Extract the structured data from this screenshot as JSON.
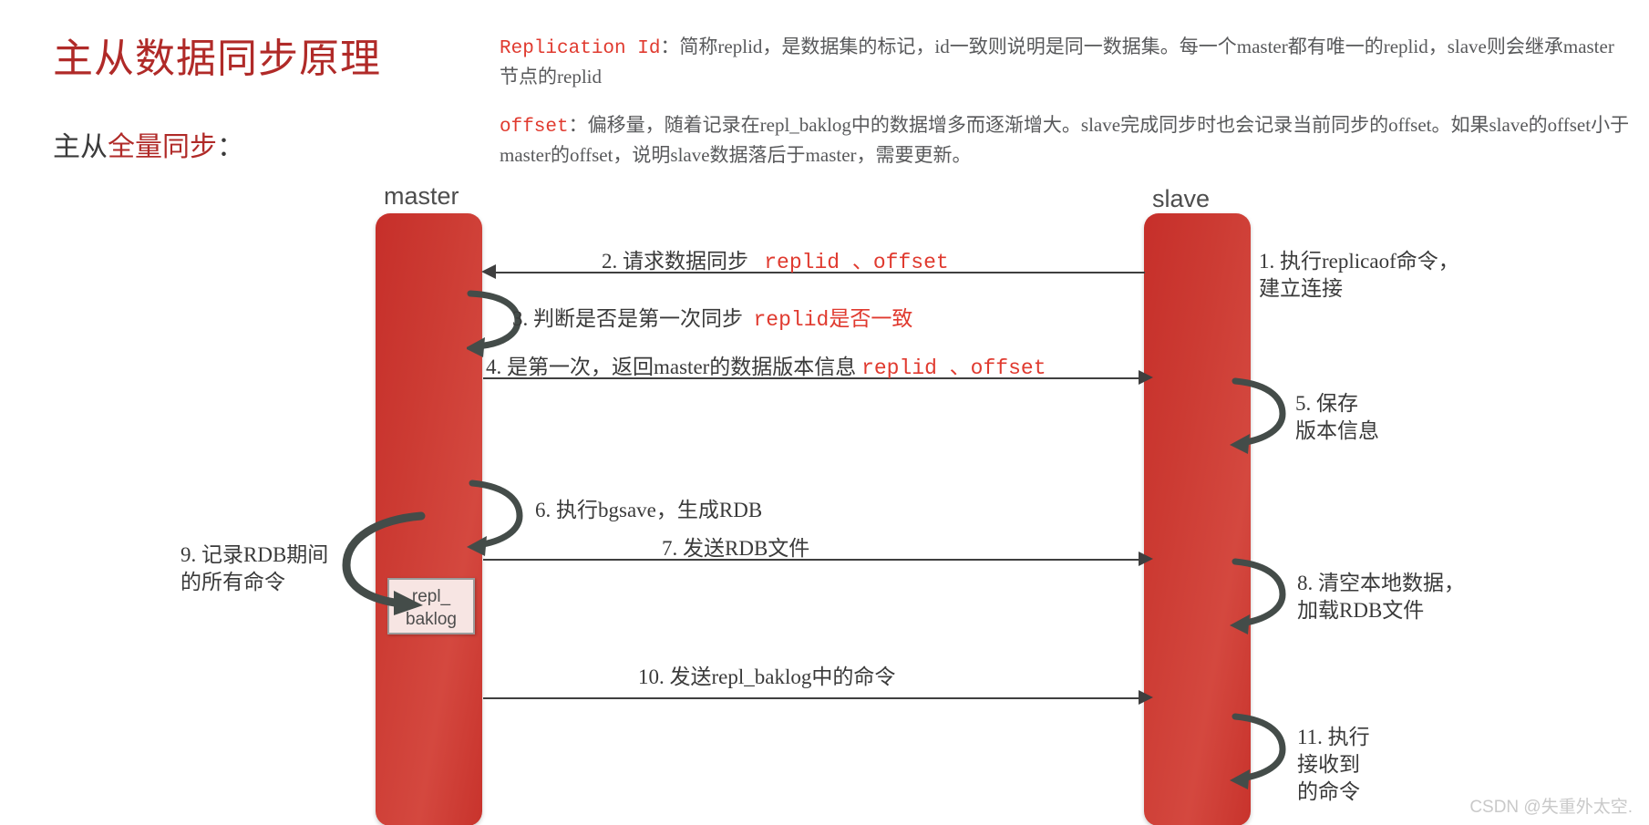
{
  "page": {
    "title": "主从数据同步原理",
    "subtitle_prefix": "主从",
    "subtitle_highlight": "全量同步",
    "subtitle_suffix": "：",
    "watermark": "CSDN @失重外太空."
  },
  "notes": {
    "replid": {
      "term": "Replication Id",
      "body": "：简称replid，是数据集的标记，id一致则说明是同一数据集。每一个master都有唯一的replid，slave则会继承master节点的replid"
    },
    "offset": {
      "term": "offset",
      "body": "：偏移量，随着记录在repl_baklog中的数据增多而逐渐增大。slave完成同步时也会记录当前同步的offset。如果slave的offset小于master的offset，说明slave数据落后于master，需要更新。"
    }
  },
  "nodes": {
    "master_label": "master",
    "slave_label": "slave",
    "repl_baklog_line1": "repl_",
    "repl_baklog_line2": "baklog"
  },
  "messages": {
    "step2": {
      "text": "2. 请求数据同步",
      "code": "replid 、offset"
    },
    "step3": {
      "text": "3. 判断是否是第一次同步",
      "code": "replid是否一致"
    },
    "step4": {
      "text": "4. 是第一次，返回master的数据版本信息",
      "code": "replid 、offset"
    },
    "step6": {
      "text": "6. 执行bgsave，生成RDB"
    },
    "step7": {
      "text": "7. 发送RDB文件"
    },
    "step10": {
      "text": "10. 发送repl_baklog中的命令"
    }
  },
  "side_notes": {
    "step1": "1. 执行replicaof命令，\n建立连接",
    "step5": "5. 保存\n版本信息",
    "step8": "8. 清空本地数据，\n加载RDB文件",
    "step9": "9. 记录RDB期间\n的所有命令",
    "step11": "11. 执行\n接收到\n的命令"
  },
  "colors": {
    "accent_red": "#b02a28",
    "code_red": "#e03a2f",
    "node_red": "#cc3b33",
    "text_gray": "#3a3a3a",
    "note_gray": "#58595b"
  }
}
